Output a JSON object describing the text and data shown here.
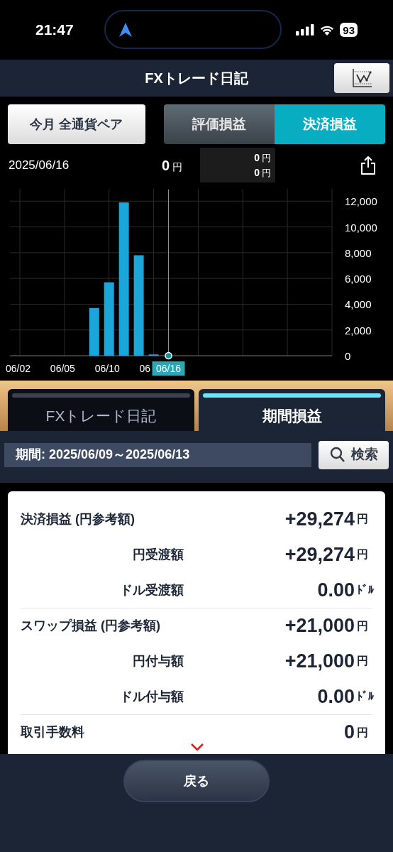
{
  "status_bar": {
    "time": "21:47",
    "battery": "93"
  },
  "header": {
    "title": "FXトレード日記"
  },
  "filter_button": {
    "label": "今月 全通貨ペア"
  },
  "mode_tabs": [
    {
      "label": "評価損益",
      "selected": false
    },
    {
      "label": "決済損益",
      "selected": true
    }
  ],
  "summary": {
    "date": "2025/06/16",
    "total": "0",
    "total_unit": "円",
    "breakdown": [
      {
        "value": "0",
        "unit": "円"
      },
      {
        "value": "0",
        "unit": "円"
      }
    ]
  },
  "chart": {
    "chart_data": {
      "type": "bar",
      "categories": [
        "06/02",
        null,
        null,
        "06/05",
        null,
        null,
        "06/10",
        null,
        null,
        "06",
        "06/16",
        null,
        null,
        null,
        null,
        null,
        null,
        null,
        null,
        null,
        null,
        null
      ],
      "values": [
        0,
        0,
        0,
        0,
        0,
        3700,
        5700,
        11900,
        7800,
        100,
        0,
        null,
        null,
        null,
        null,
        null,
        null,
        null,
        null,
        null,
        null,
        null
      ],
      "ylim": [
        0,
        12900
      ],
      "yticks": [
        {
          "value": 0,
          "label": "0"
        },
        {
          "value": 2000,
          "label": "2,000"
        },
        {
          "value": 4000,
          "label": "4,000"
        },
        {
          "value": 6000,
          "label": "6,000"
        },
        {
          "value": 8000,
          "label": "8,000"
        },
        {
          "value": 10000,
          "label": "10,000"
        },
        {
          "value": 12000,
          "label": "12,000"
        }
      ],
      "grid": true,
      "annotations": [
        {
          "x": "06/16"
        }
      ]
    }
  },
  "section_tabs": [
    {
      "label": "FXトレード日記",
      "selected": false
    },
    {
      "label": "期間損益",
      "selected": true
    }
  ],
  "period": {
    "text": "期間: 2025/06/09～2025/06/13",
    "search_label": "検索"
  },
  "rows": [
    {
      "label": "決済損益 (円参考額)",
      "kind": "main",
      "value": "+29,274",
      "unit": "円"
    },
    {
      "label": "円受渡額",
      "kind": "sub",
      "value": "+29,274",
      "unit": "円"
    },
    {
      "label": "ドル受渡額",
      "kind": "sub",
      "value": "0.00",
      "unit": "ﾄﾞﾙ"
    },
    {
      "label": "スワップ損益 (円参考額)",
      "kind": "main",
      "value": "+21,000",
      "unit": "円"
    },
    {
      "label": "円付与額",
      "kind": "sub",
      "value": "+21,000",
      "unit": "円"
    },
    {
      "label": "ドル付与額",
      "kind": "sub",
      "value": "0.00",
      "unit": "ﾄﾞﾙ"
    },
    {
      "label": "取引手数料",
      "kind": "main",
      "value": "0",
      "unit": "円"
    }
  ],
  "back_button": {
    "label": "戻る"
  }
}
